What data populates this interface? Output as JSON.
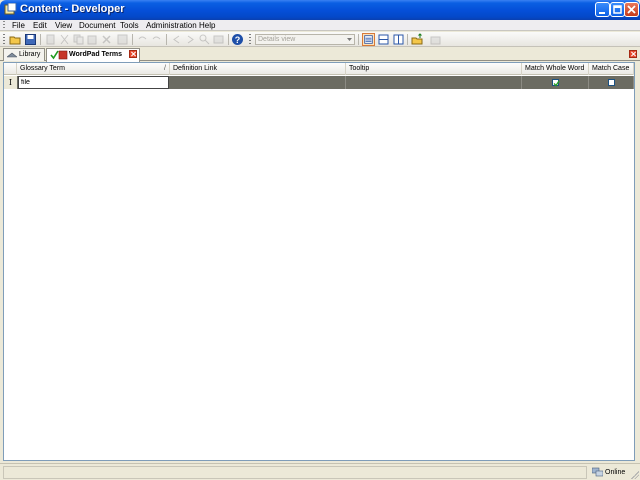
{
  "window": {
    "title": "Content - Developer",
    "buttons": [
      "minimize-icon",
      "maximize-icon",
      "close-icon"
    ]
  },
  "menu": {
    "items": [
      "File",
      "Edit",
      "View",
      "Document",
      "Tools",
      "Administration",
      "Help"
    ]
  },
  "toolbar": {
    "view_select_value": "Details view",
    "icons": [
      "open-folder-icon",
      "save-icon",
      "help-icon",
      "details-view-icon",
      "list-view-icon",
      "columns-icon",
      "folder-up-icon",
      "sync-icon"
    ]
  },
  "tabs": [
    {
      "label": "Library",
      "icon": "library-icon"
    },
    {
      "label": "WordPad Terms",
      "icon": "check-doc-icon",
      "active": true
    }
  ],
  "grid": {
    "columns": [
      "Glossary Term",
      "Definition Link",
      "Tooltip",
      "Match Whole Word",
      "Match Case"
    ],
    "sort_column": "Glossary Term",
    "rows": [
      {
        "glossary_term": "file",
        "definition_link": "",
        "tooltip": "",
        "match_whole_word": true,
        "match_case": false
      }
    ],
    "row_indicator": "I"
  },
  "status": {
    "connection": "Online"
  },
  "colors": {
    "title_bar": "#0550d9",
    "selected_row": "#6c6c62",
    "tab_close": "#e84a2e"
  }
}
